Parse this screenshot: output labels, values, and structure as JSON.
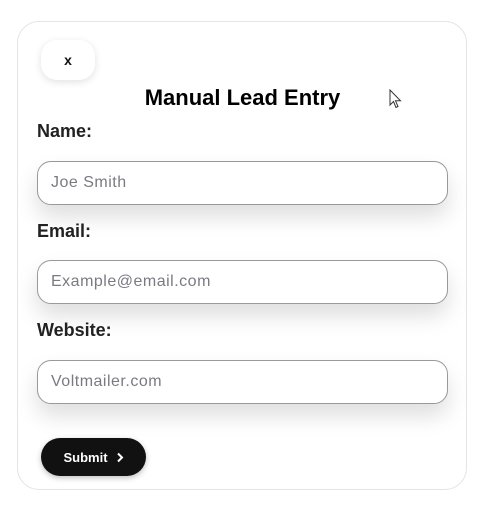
{
  "form": {
    "close_label": "x",
    "title": "Manual Lead Entry",
    "fields": [
      {
        "label": "Name:",
        "placeholder": "Joe Smith",
        "value": ""
      },
      {
        "label": "Email:",
        "placeholder": "Example@email.com",
        "value": ""
      },
      {
        "label": "Website:",
        "placeholder": "Voltmailer.com",
        "value": ""
      }
    ],
    "submit_label": "Submit",
    "submit_icon": "chevron-right-icon"
  },
  "colors": {
    "button_bg": "#111111",
    "button_text": "#ffffff",
    "input_border": "#999999"
  }
}
